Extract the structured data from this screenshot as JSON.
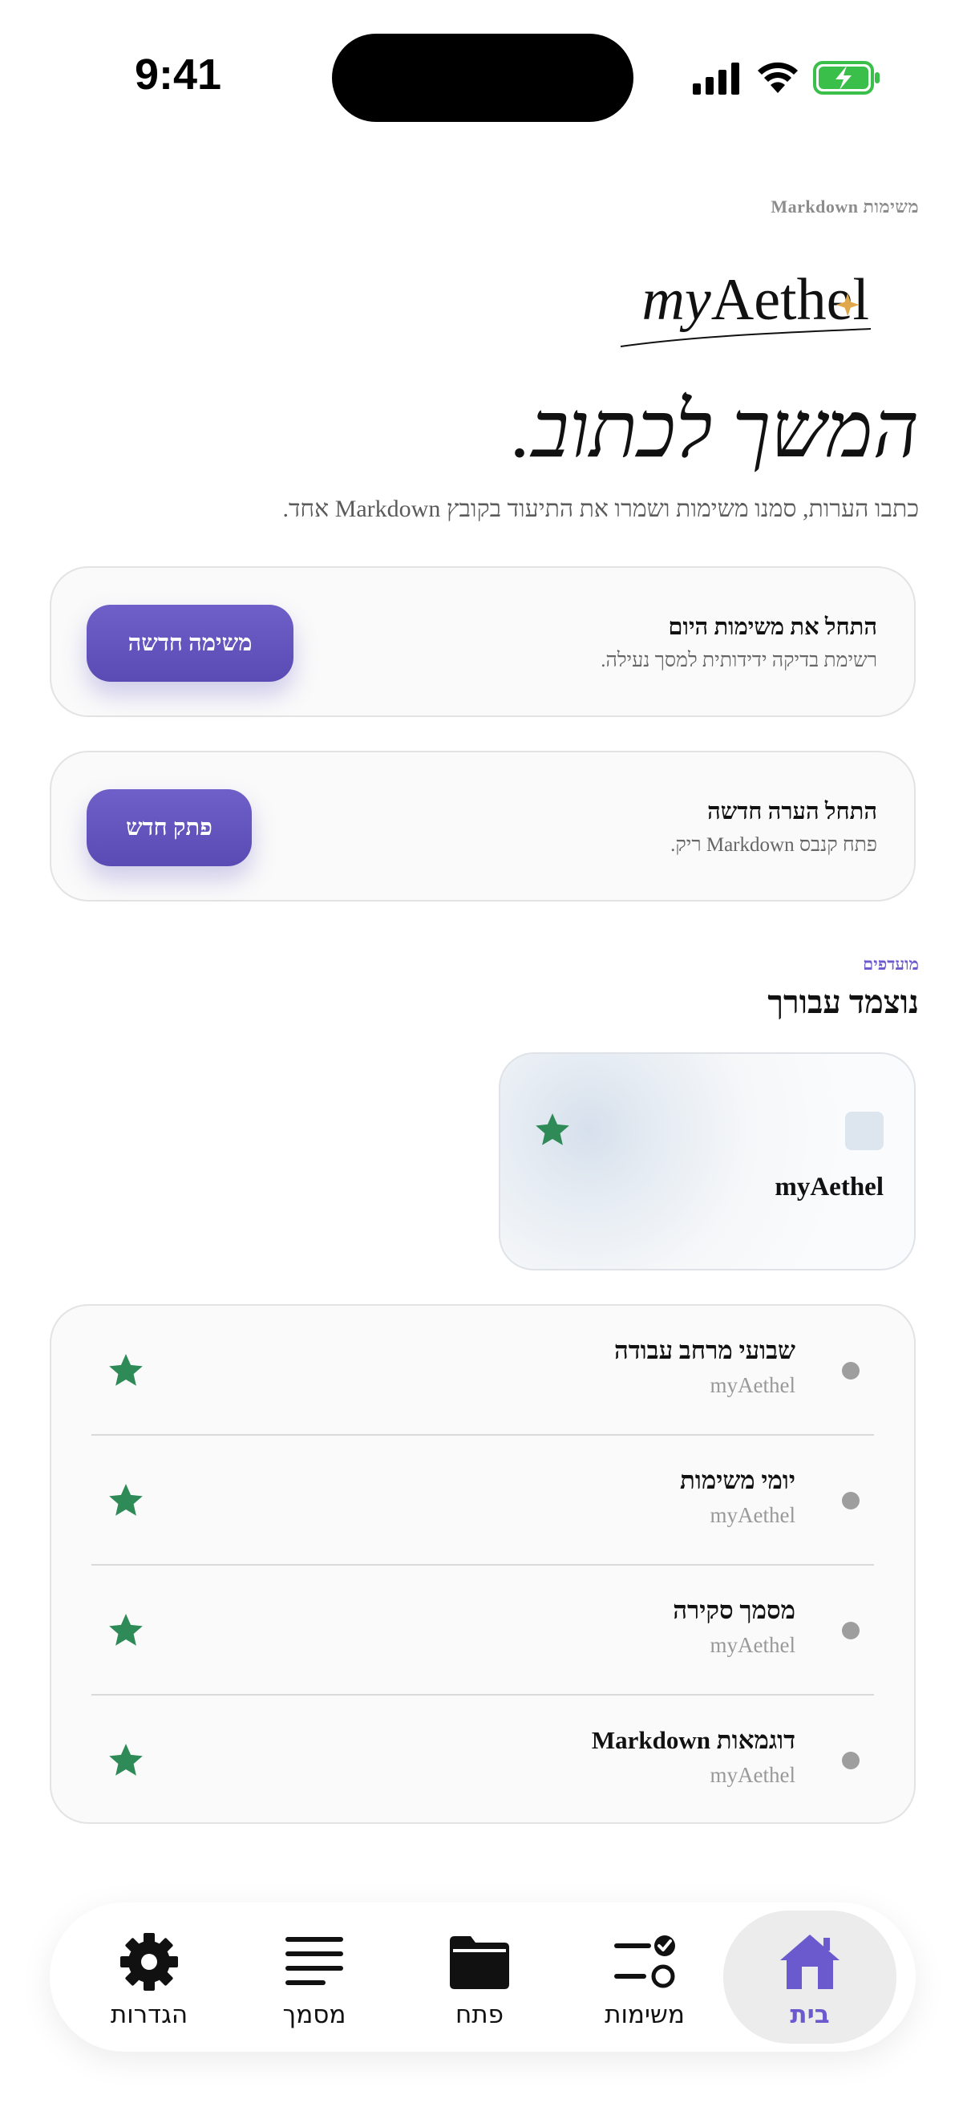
{
  "status_bar": {
    "time": "9:41"
  },
  "header": {
    "eyebrow": "משימות Markdown",
    "logo_text": "myAethel",
    "title": "המשך לכתוב.",
    "subtitle": "כתבו הערות, סמנו משימות ושמרו את התיעוד בקובץ Markdown אחד."
  },
  "actions": [
    {
      "title": "התחל את משימות היום",
      "description": "רשימת בדיקה ידידותית למסך נעילה.",
      "button": "משימה חדשה"
    },
    {
      "title": "התחל הערה חדשה",
      "description": "פתח קנבס Markdown ריק.",
      "button": "פתק חדש"
    }
  ],
  "favorites": {
    "eyebrow": "מועדפים",
    "title": "נוצמד עבורך",
    "pinned": {
      "name": "myAethel"
    },
    "items": [
      {
        "title": "שבועי מרחב עבודה",
        "subtitle": "myAethel"
      },
      {
        "title": "יומי משימות",
        "subtitle": "myAethel"
      },
      {
        "title": "מסמך סקירה",
        "subtitle": "myAethel"
      },
      {
        "title": "דוגמאות Markdown",
        "subtitle": "myAethel"
      }
    ]
  },
  "tabbar": {
    "tabs": [
      {
        "label": "בית",
        "icon": "home-icon",
        "active": true
      },
      {
        "label": "משימות",
        "icon": "tasks-icon",
        "active": false
      },
      {
        "label": "פתח",
        "icon": "folder-icon",
        "active": false
      },
      {
        "label": "מסמך",
        "icon": "document-lines-icon",
        "active": false
      },
      {
        "label": "הגדרות",
        "icon": "gear-icon",
        "active": false
      }
    ]
  },
  "colors": {
    "accent": "#6a5acd",
    "star": "#2e8b57",
    "logo_star": "#e0a84a"
  }
}
